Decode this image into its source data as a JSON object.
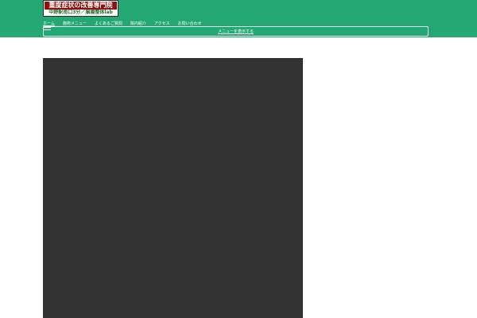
{
  "logo": {
    "title": "重度症状の改善専門院",
    "subtitle": "中野駅南口3分／脳腸整体lab"
  },
  "nav": {
    "items": [
      {
        "label": "ホーム"
      },
      {
        "label": "施術メニュー"
      },
      {
        "label": "よくあるご質問"
      },
      {
        "label": "院内紹介"
      },
      {
        "label": "アクセス"
      },
      {
        "label": "お問い合わせ"
      }
    ]
  },
  "menu_bar": {
    "label": "メニューを表示する"
  },
  "colors": {
    "header_green": "#23a873",
    "logo_red": "#8c1111",
    "video_bg": "#333333"
  }
}
